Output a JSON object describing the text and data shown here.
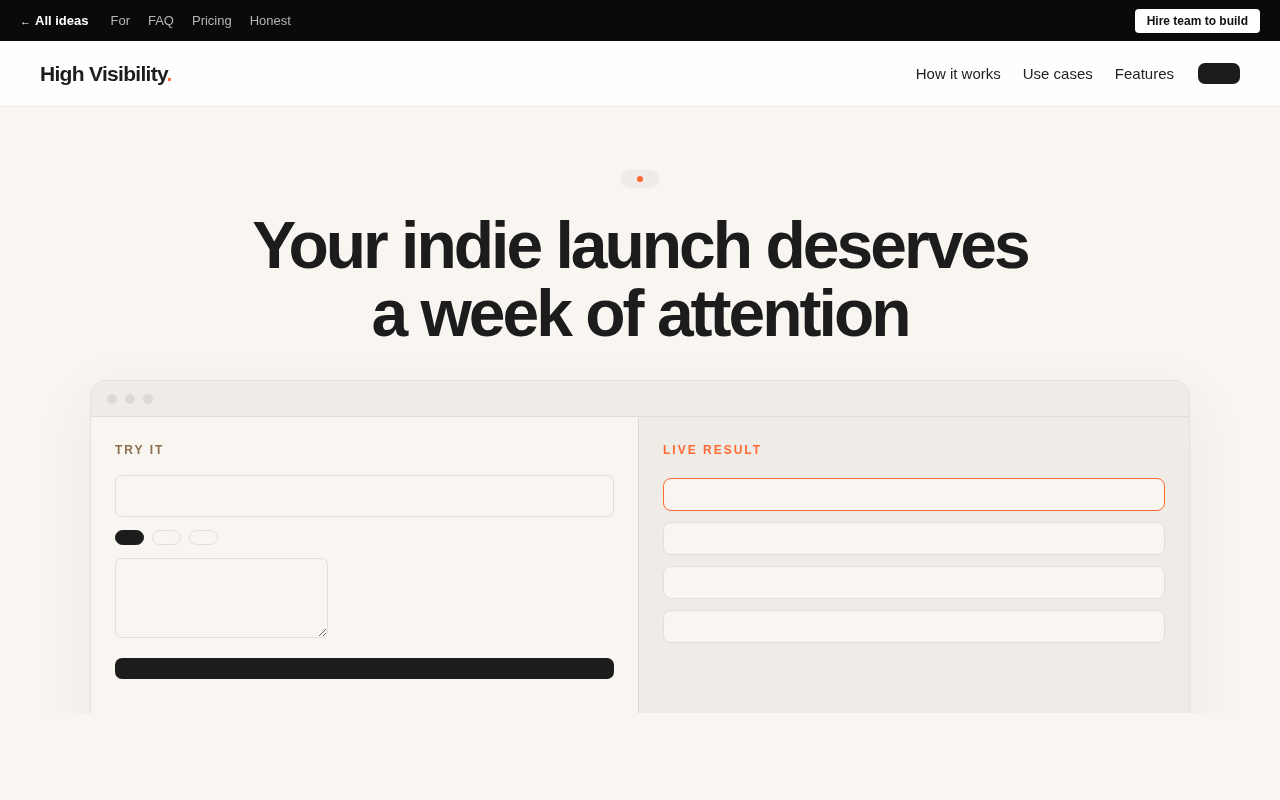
{
  "top_bar": {
    "back_link": {
      "arrow": "←",
      "label": "All ideas"
    },
    "links": [
      "For",
      "FAQ",
      "Pricing",
      "Honest"
    ],
    "cta": "Hire team to build"
  },
  "header": {
    "logo": {
      "name": "High Visibility",
      "mark": "."
    },
    "nav": [
      "How it works",
      "Use cases",
      "Features"
    ]
  },
  "hero": {
    "title_lines": [
      "Your indie launch deserves",
      "a week of attention"
    ]
  },
  "demo": {
    "form": {
      "label": "TRY IT",
      "chips": [
        {
          "selected": true
        },
        {
          "selected": false
        },
        {
          "selected": false
        }
      ]
    },
    "result": {
      "label": "LIVE RESULT",
      "rows": [
        {
          "highlighted": true
        },
        {
          "highlighted": false
        },
        {
          "highlighted": false
        },
        {
          "highlighted": false
        }
      ]
    }
  }
}
